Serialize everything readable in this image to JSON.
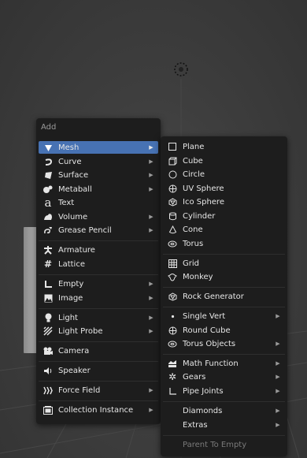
{
  "add_menu": {
    "title": "Add",
    "items": [
      {
        "label": "Mesh",
        "icon": "mesh-icon",
        "submenu": true,
        "highlighted": true
      },
      {
        "label": "Curve",
        "icon": "curve-icon",
        "submenu": true
      },
      {
        "label": "Surface",
        "icon": "surface-icon",
        "submenu": true
      },
      {
        "label": "Metaball",
        "icon": "metaball-icon",
        "submenu": true
      },
      {
        "label": "Text",
        "icon": "text-icon",
        "submenu": false
      },
      {
        "label": "Volume",
        "icon": "volume-icon",
        "submenu": true
      },
      {
        "label": "Grease Pencil",
        "icon": "grease-pencil-icon",
        "submenu": true
      },
      {
        "label": "Armature",
        "icon": "armature-icon",
        "submenu": false
      },
      {
        "label": "Lattice",
        "icon": "lattice-icon",
        "submenu": false
      },
      {
        "label": "Empty",
        "icon": "empty-icon",
        "submenu": true
      },
      {
        "label": "Image",
        "icon": "image-icon",
        "submenu": true
      },
      {
        "label": "Light",
        "icon": "light-icon",
        "submenu": true
      },
      {
        "label": "Light Probe",
        "icon": "light-probe-icon",
        "submenu": true
      },
      {
        "label": "Camera",
        "icon": "camera-icon",
        "submenu": false
      },
      {
        "label": "Speaker",
        "icon": "speaker-icon",
        "submenu": false
      },
      {
        "label": "Force Field",
        "icon": "force-field-icon",
        "submenu": true
      },
      {
        "label": "Collection Instance",
        "icon": "collection-instance-icon",
        "submenu": true
      }
    ]
  },
  "mesh_menu": {
    "items": [
      {
        "label": "Plane",
        "icon": "plane-icon",
        "submenu": false
      },
      {
        "label": "Cube",
        "icon": "cube-icon",
        "submenu": false
      },
      {
        "label": "Circle",
        "icon": "circle-icon",
        "submenu": false
      },
      {
        "label": "UV Sphere",
        "icon": "uv-sphere-icon",
        "submenu": false
      },
      {
        "label": "Ico Sphere",
        "icon": "ico-sphere-icon",
        "submenu": false
      },
      {
        "label": "Cylinder",
        "icon": "cylinder-icon",
        "submenu": false
      },
      {
        "label": "Cone",
        "icon": "cone-icon",
        "submenu": false
      },
      {
        "label": "Torus",
        "icon": "torus-icon",
        "submenu": false
      },
      {
        "label": "Grid",
        "icon": "grid-icon",
        "submenu": false
      },
      {
        "label": "Monkey",
        "icon": "monkey-icon",
        "submenu": false
      },
      {
        "label": "Rock Generator",
        "icon": "rock-generator-icon",
        "submenu": false
      },
      {
        "label": "Single Vert",
        "icon": "single-vert-icon",
        "submenu": true
      },
      {
        "label": "Round Cube",
        "icon": "round-cube-icon",
        "submenu": false
      },
      {
        "label": "Torus Objects",
        "icon": "torus-objects-icon",
        "submenu": true
      },
      {
        "label": "Math Function",
        "icon": "math-function-icon",
        "submenu": true
      },
      {
        "label": "Gears",
        "icon": "gears-icon",
        "submenu": true
      },
      {
        "label": "Pipe Joints",
        "icon": "pipe-joints-icon",
        "submenu": true
      },
      {
        "label": "Diamonds",
        "icon": "",
        "submenu": true
      },
      {
        "label": "Extras",
        "icon": "",
        "submenu": true
      },
      {
        "label": "Parent To Empty",
        "icon": "",
        "submenu": false,
        "disabled": true
      }
    ]
  },
  "colors": {
    "menu_bg": "#1d1d1d",
    "highlight": "#4772b3",
    "text": "#e6e6e6",
    "viewport_bg": "#3b3b3b"
  }
}
